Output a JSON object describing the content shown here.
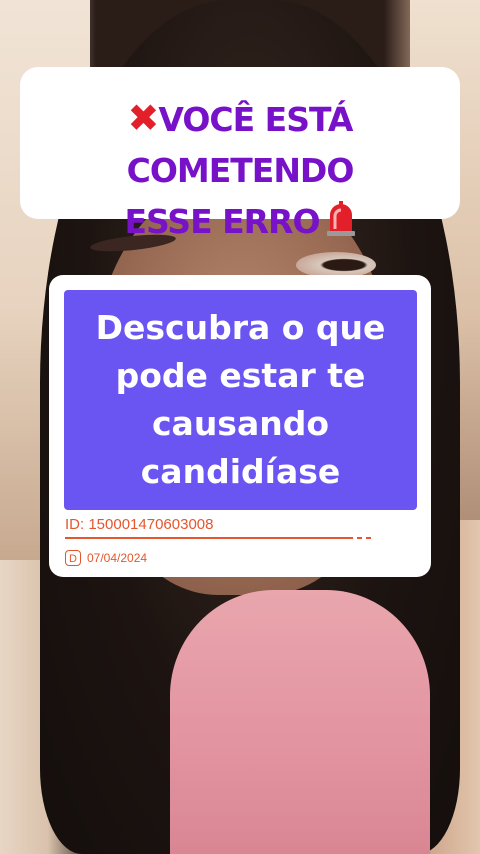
{
  "headline": {
    "line1": "VOCÊ ESTÁ COMETENDO",
    "line2": "ESSE ERRO",
    "icons": [
      "cross-mark-icon",
      "siren-icon"
    ],
    "text_color": "#7712c9",
    "cross_color": "#e3202a"
  },
  "card": {
    "lines": [
      "Descubra o que",
      "pode estar te",
      "causando",
      "candidíase"
    ],
    "box_color": "#6a55f2",
    "id_text": "ID: 150001470603008",
    "date_icon_letter": "D",
    "date": "07/04/2024",
    "meta_color": "#e4572e"
  }
}
